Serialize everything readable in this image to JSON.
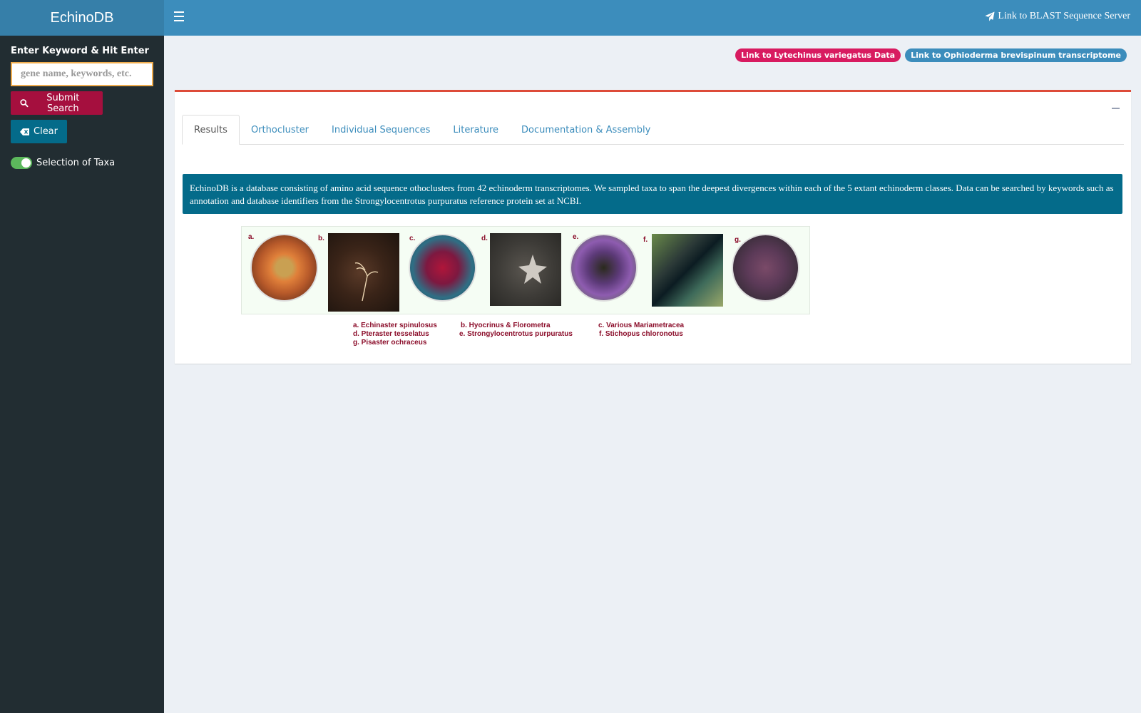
{
  "brand": "EchinoDB",
  "sidebar": {
    "keyword_label": "Enter Keyword & Hit Enter",
    "search_placeholder": "gene name, keywords, etc.",
    "submit_label": "Submit Search",
    "clear_label": "Clear",
    "taxa_toggle_label": "Selection of Taxa",
    "taxa_toggle_on": true
  },
  "header": {
    "blast_link": "Link to BLAST Sequence Server"
  },
  "badges": [
    {
      "label": "Link to Lytechinus variegatus Data",
      "color": "#d81b60"
    },
    {
      "label": "Link to Ophioderma brevispinum transcriptome",
      "color": "#3c8dbc"
    }
  ],
  "tabs": [
    {
      "label": "Results",
      "active": true
    },
    {
      "label": "Orthocluster",
      "active": false
    },
    {
      "label": "Individual Sequences",
      "active": false
    },
    {
      "label": "Literature",
      "active": false
    },
    {
      "label": "Documentation & Assembly",
      "active": false
    }
  ],
  "info_text": "EchinoDB is a database consisting of amino acid sequence othoclusters from 42 echinoderm transcriptomes. We sampled taxa to span the deepest divergences within each of the 5 extant echinoderm classes. Data can be searched by keywords such as annotation and database identifiers from the Strongylocentrotus purpuratus reference protein set at NCBI.",
  "figure": {
    "panels": [
      "a.",
      "b.",
      "c.",
      "d.",
      "e.",
      "f.",
      "g."
    ],
    "captions": [
      "a. Echinaster spinulosus",
      "b. Hyocrinus & Florometra",
      "c. Various Mariametracea",
      "d. Pteraster tesselatus",
      "e. Strongylocentrotus purpuratus",
      "f. Stichopus chloronotus",
      "g. Pisaster ochraceus"
    ]
  },
  "colors": {
    "header": "#3c8dbc",
    "sidebar": "#222d32",
    "submit": "#a50f3e",
    "clear": "#046b8a",
    "box_accent": "#dd4b39"
  }
}
